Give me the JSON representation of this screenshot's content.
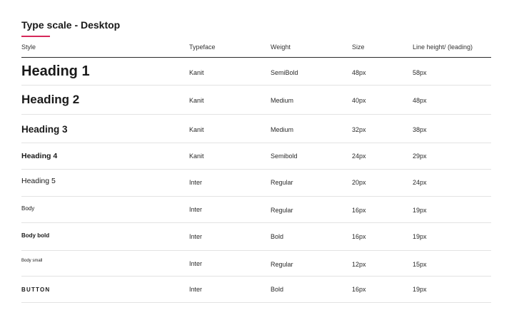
{
  "title": "Type scale - Desktop",
  "accent_color": "#d6285a",
  "columns": [
    "Style",
    "Typeface",
    "Weight",
    "Size",
    "Line height/ (leading)"
  ],
  "rows": [
    {
      "style": "Heading 1",
      "typeface": "Kanit",
      "weight": "SemiBold",
      "size": "48px",
      "line_height": "58px"
    },
    {
      "style": "Heading 2",
      "typeface": "Kanit",
      "weight": "Medium",
      "size": "40px",
      "line_height": "48px"
    },
    {
      "style": "Heading 3",
      "typeface": "Kanit",
      "weight": "Medium",
      "size": "32px",
      "line_height": "38px"
    },
    {
      "style": "Heading 4",
      "typeface": "Kanit",
      "weight": "Semibold",
      "size": "24px",
      "line_height": "29px"
    },
    {
      "style": "Heading 5",
      "typeface": "Inter",
      "weight": "Regular",
      "size": "20px",
      "line_height": "24px"
    },
    {
      "style": "Body",
      "typeface": "Inter",
      "weight": "Regular",
      "size": "16px",
      "line_height": "19px"
    },
    {
      "style": "Body bold",
      "typeface": "Inter",
      "weight": "Bold",
      "size": "16px",
      "line_height": "19px"
    },
    {
      "style": "Body small",
      "typeface": "Inter",
      "weight": "Regular",
      "size": "12px",
      "line_height": "15px"
    },
    {
      "style": "BUTTON",
      "typeface": "Inter",
      "weight": "Bold",
      "size": "16px",
      "line_height": "19px"
    }
  ]
}
